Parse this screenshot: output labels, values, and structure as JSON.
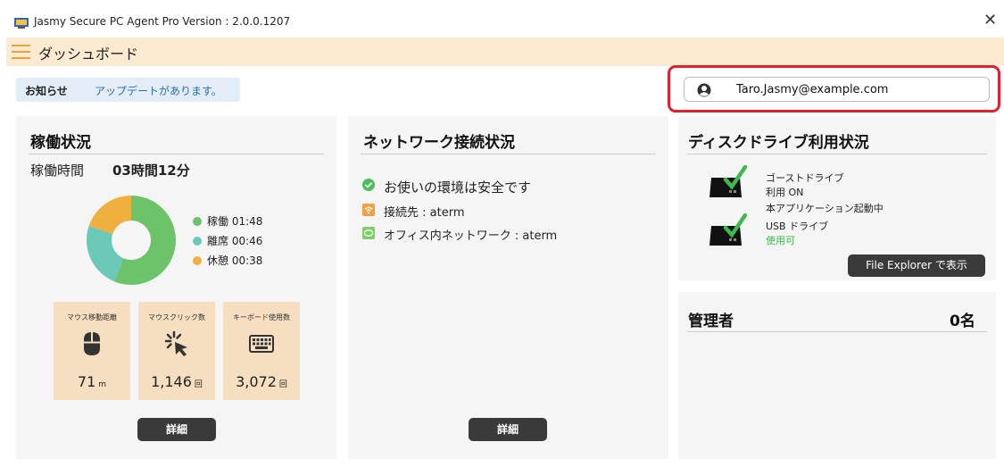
{
  "window": {
    "title": "Jasmy Secure PC Agent Pro Version : 2.0.0.1207",
    "close_symbol": "✕"
  },
  "header": {
    "title": "ダッシュボード"
  },
  "notice": {
    "label": "お知らせ",
    "message": "アップデートがあります。"
  },
  "user": {
    "email": "Taro.Jasmy@example.com"
  },
  "activity": {
    "title": "稼働状況",
    "uptime_label": "稼働時間",
    "uptime_value": "03時間12分",
    "legend": [
      {
        "label": "稼働 01:48",
        "color": "#6cc36a"
      },
      {
        "label": "離席 00:46",
        "color": "#6cc9b8"
      },
      {
        "label": "休憩 00:38",
        "color": "#f0b040"
      }
    ],
    "stats": [
      {
        "label": "マウス移動距離",
        "value": "71",
        "unit": "m",
        "icon": "mouse-icon"
      },
      {
        "label": "マウスクリック数",
        "value": "1,146",
        "unit": "回",
        "icon": "click-icon"
      },
      {
        "label": "キーボード使用数",
        "value": "3,072",
        "unit": "回",
        "icon": "keyboard-icon"
      }
    ],
    "details_button": "詳細"
  },
  "chart_data": {
    "type": "pie",
    "categories": [
      "稼働",
      "離席",
      "休憩"
    ],
    "values": [
      108,
      46,
      38
    ],
    "colors": [
      "#6cc36a",
      "#6cc9b8",
      "#f0b040"
    ],
    "title": "",
    "donut": true
  },
  "network": {
    "title": "ネットワーク接続状況",
    "status": "お使いの環境は安全です",
    "connection": "接続先 : aterm",
    "office_network": "オフィス内ネットワーク : aterm",
    "details_button": "詳細"
  },
  "disk": {
    "title": "ディスクドライブ利用状況",
    "ghost_drive_label": "ゴーストドライブ",
    "ghost_drive_status": "利用 ON",
    "app_status": "本アプリケーション起動中",
    "usb_drive_label": "USB ドライブ",
    "usb_drive_status": "使用可",
    "file_explorer_button": "File Explorer で表示"
  },
  "admins": {
    "title": "管理者",
    "count": "0名"
  }
}
